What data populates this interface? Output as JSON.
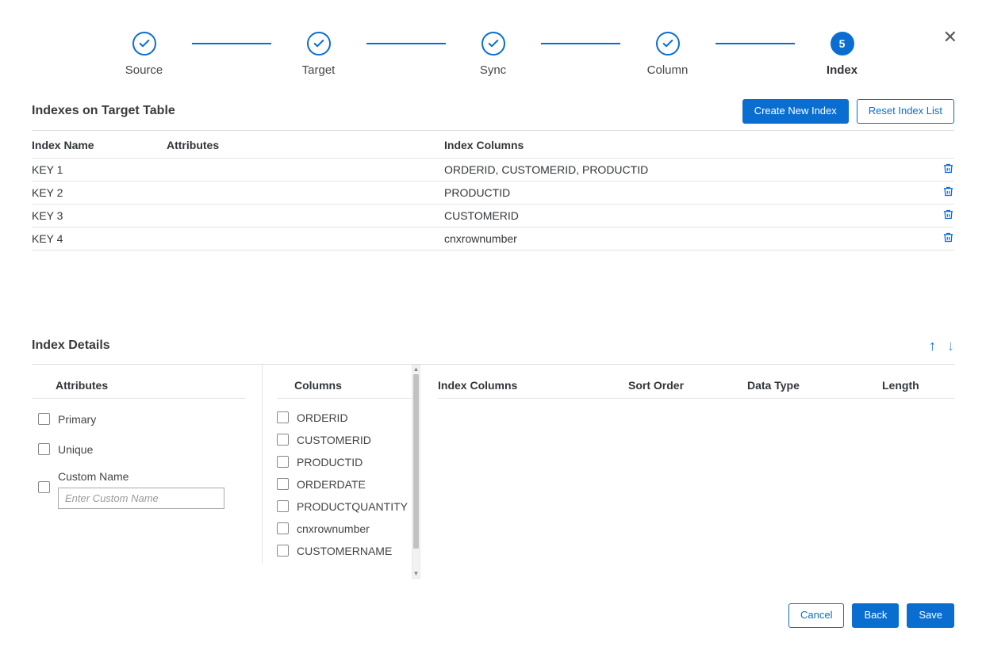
{
  "close_icon": "✕",
  "steps": [
    {
      "label": "Source",
      "done": true
    },
    {
      "label": "Target",
      "done": true
    },
    {
      "label": "Sync",
      "done": true
    },
    {
      "label": "Column",
      "done": true
    },
    {
      "label": "Index",
      "number": "5",
      "active": true
    }
  ],
  "indexes_section": {
    "title": "Indexes on Target Table",
    "create_btn": "Create New Index",
    "reset_btn": "Reset Index List",
    "headers": {
      "name": "Index Name",
      "attr": "Attributes",
      "cols": "Index Columns"
    },
    "rows": [
      {
        "name": "KEY 1",
        "attr": "",
        "cols": "ORDERID, CUSTOMERID, PRODUCTID"
      },
      {
        "name": "KEY 2",
        "attr": "",
        "cols": "PRODUCTID"
      },
      {
        "name": "KEY 3",
        "attr": "",
        "cols": "CUSTOMERID"
      },
      {
        "name": "KEY 4",
        "attr": "",
        "cols": "cnxrownumber"
      }
    ]
  },
  "details_section": {
    "title": "Index Details",
    "attrs_header": "Attributes",
    "cols_header": "Columns",
    "primary_label": "Primary",
    "unique_label": "Unique",
    "custom_name_label": "Custom Name",
    "custom_name_placeholder": "Enter Custom Name",
    "columns": [
      "ORDERID",
      "CUSTOMERID",
      "PRODUCTID",
      "ORDERDATE",
      "PRODUCTQUANTITY",
      "cnxrownumber",
      "CUSTOMERNAME"
    ],
    "detail_headers": {
      "cols": "Index Columns",
      "sort": "Sort Order",
      "type": "Data Type",
      "len": "Length"
    }
  },
  "footer": {
    "cancel": "Cancel",
    "back": "Back",
    "save": "Save"
  }
}
